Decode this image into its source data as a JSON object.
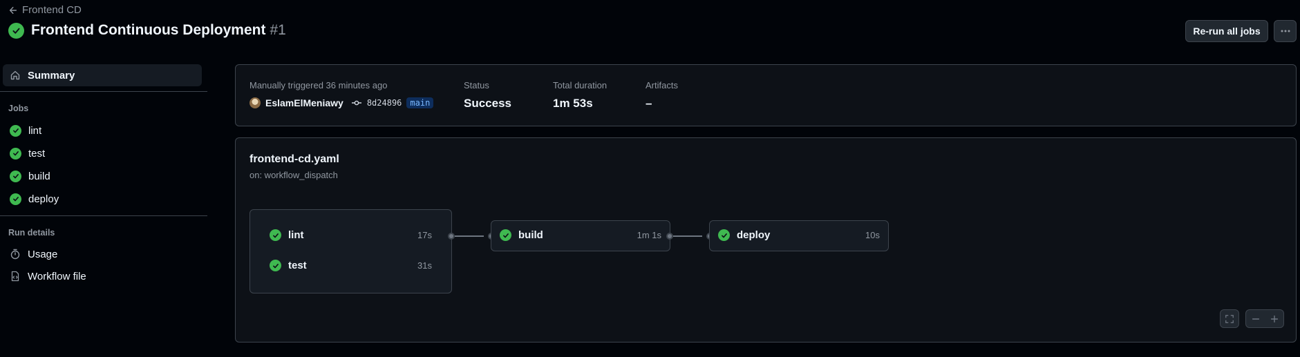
{
  "header": {
    "back_label": "Frontend CD",
    "title": "Frontend Continuous Deployment",
    "run_number": "#1",
    "rerun_label": "Re-run all jobs"
  },
  "sidebar": {
    "summary_label": "Summary",
    "jobs_heading": "Jobs",
    "jobs": [
      {
        "label": "lint",
        "status": "success"
      },
      {
        "label": "test",
        "status": "success"
      },
      {
        "label": "build",
        "status": "success"
      },
      {
        "label": "deploy",
        "status": "success"
      }
    ],
    "run_details_heading": "Run details",
    "usage_label": "Usage",
    "workflow_file_label": "Workflow file"
  },
  "summary": {
    "trigger_text": "Manually triggered 36 minutes ago",
    "actor": "EslamElMeniawy",
    "commit": "8d24896",
    "branch": "main",
    "status_label": "Status",
    "status_value": "Success",
    "duration_label": "Total duration",
    "duration_value": "1m 53s",
    "artifacts_label": "Artifacts",
    "artifacts_value": "–"
  },
  "graph": {
    "workflow_file": "frontend-cd.yaml",
    "trigger": "on: workflow_dispatch",
    "jobs": {
      "lint": {
        "name": "lint",
        "duration": "17s"
      },
      "test": {
        "name": "test",
        "duration": "31s"
      },
      "build": {
        "name": "build",
        "duration": "1m 1s"
      },
      "deploy": {
        "name": "deploy",
        "duration": "10s"
      }
    }
  },
  "colors": {
    "success": "#3fb950",
    "background": "#010409",
    "panel": "#0d1117",
    "border": "#3d444d",
    "branch_bg": "#0d2d5c",
    "branch_fg": "#79b8ff"
  },
  "icons": [
    "arrow-left-icon",
    "check-circle-icon",
    "kebab-horizontal-icon",
    "home-icon",
    "stopwatch-icon",
    "file-code-icon",
    "git-commit-icon",
    "fullscreen-icon",
    "zoom-out-icon",
    "zoom-in-icon"
  ]
}
